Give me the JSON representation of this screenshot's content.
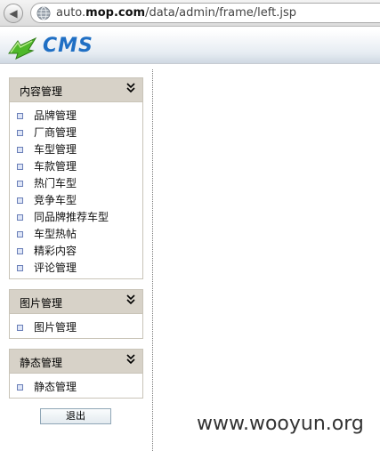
{
  "browser": {
    "url_prefix": "auto.",
    "url_domain": "mop.com",
    "url_path": "/data/admin/frame/left.jsp"
  },
  "header": {
    "logo_text": "CMS"
  },
  "panels": [
    {
      "title": "内容管理",
      "items": [
        "品牌管理",
        "厂商管理",
        "车型管理",
        "车款管理",
        "热门车型",
        "竞争车型",
        "同品牌推荐车型",
        "车型热帖",
        "精彩内容",
        "评论管理"
      ]
    },
    {
      "title": "图片管理",
      "items": [
        "图片管理"
      ]
    },
    {
      "title": "静态管理",
      "items": [
        "静态管理"
      ]
    }
  ],
  "logout_label": "退出",
  "watermark": "www.wooyun.org",
  "colors": {
    "panel_header": "#d7d2c8",
    "logo_blue": "#1f6fc4",
    "logo_green": "#4fb82a"
  }
}
